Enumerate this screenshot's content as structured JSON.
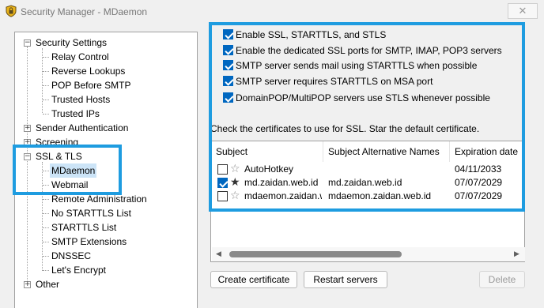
{
  "window": {
    "title": "Security Manager - MDaemon",
    "close_symbol": "✕"
  },
  "tree": {
    "items": [
      {
        "label": "Security Settings",
        "expander": "−"
      },
      {
        "label": "Relay Control"
      },
      {
        "label": "Reverse Lookups"
      },
      {
        "label": "POP Before SMTP"
      },
      {
        "label": "Trusted Hosts"
      },
      {
        "label": "Trusted IPs"
      },
      {
        "label": "Sender Authentication",
        "expander": "+"
      },
      {
        "label": "Screening",
        "expander": "+"
      },
      {
        "label": "SSL & TLS",
        "expander": "−"
      },
      {
        "label": "MDaemon",
        "selected": true
      },
      {
        "label": "Webmail"
      },
      {
        "label": "Remote Administration"
      },
      {
        "label": "No STARTTLS List"
      },
      {
        "label": "STARTTLS List"
      },
      {
        "label": "SMTP Extensions"
      },
      {
        "label": "DNSSEC"
      },
      {
        "label": "Let's Encrypt"
      },
      {
        "label": "Other",
        "expander": "+"
      }
    ]
  },
  "options": [
    {
      "label": "Enable SSL, STARTTLS, and STLS",
      "checked": true
    },
    {
      "label": "Enable the dedicated SSL ports for SMTP, IMAP, POP3 servers",
      "checked": true
    },
    {
      "label": "SMTP server sends mail using STARTTLS when possible",
      "checked": true
    },
    {
      "label": "SMTP server requires STARTTLS on MSA port",
      "checked": true
    },
    {
      "label": "DomainPOP/MultiPOP servers use STLS whenever possible",
      "checked": true
    }
  ],
  "instructions": "Check the certificates to use for SSL.  Star the default certificate.",
  "certificates": {
    "columns": [
      "Subject",
      "Subject Alternative Names",
      "Expiration date"
    ],
    "rows": [
      {
        "subject": "AutoHotkey",
        "alt_names": "",
        "expiration": "04/11/2033",
        "checked": false,
        "default": false
      },
      {
        "subject": "md.zaidan.web.id",
        "alt_names": "md.zaidan.web.id",
        "expiration": "07/07/2029",
        "checked": true,
        "default": true
      },
      {
        "subject": "mdaemon.zaidan.w...",
        "alt_names": "mdaemon.zaidan.web.id",
        "expiration": "07/07/2029",
        "checked": false,
        "default": false
      }
    ],
    "star_filled": "★",
    "star_empty": "☆",
    "scroll_left": "◀",
    "scroll_right": "▶"
  },
  "buttons": {
    "create": "Create certificate",
    "restart": "Restart servers",
    "delete": "Delete"
  },
  "colors": {
    "highlight_box": "#1e9ce0",
    "checkbox_checked": "#0067c0",
    "selection": "#cce4f7"
  }
}
